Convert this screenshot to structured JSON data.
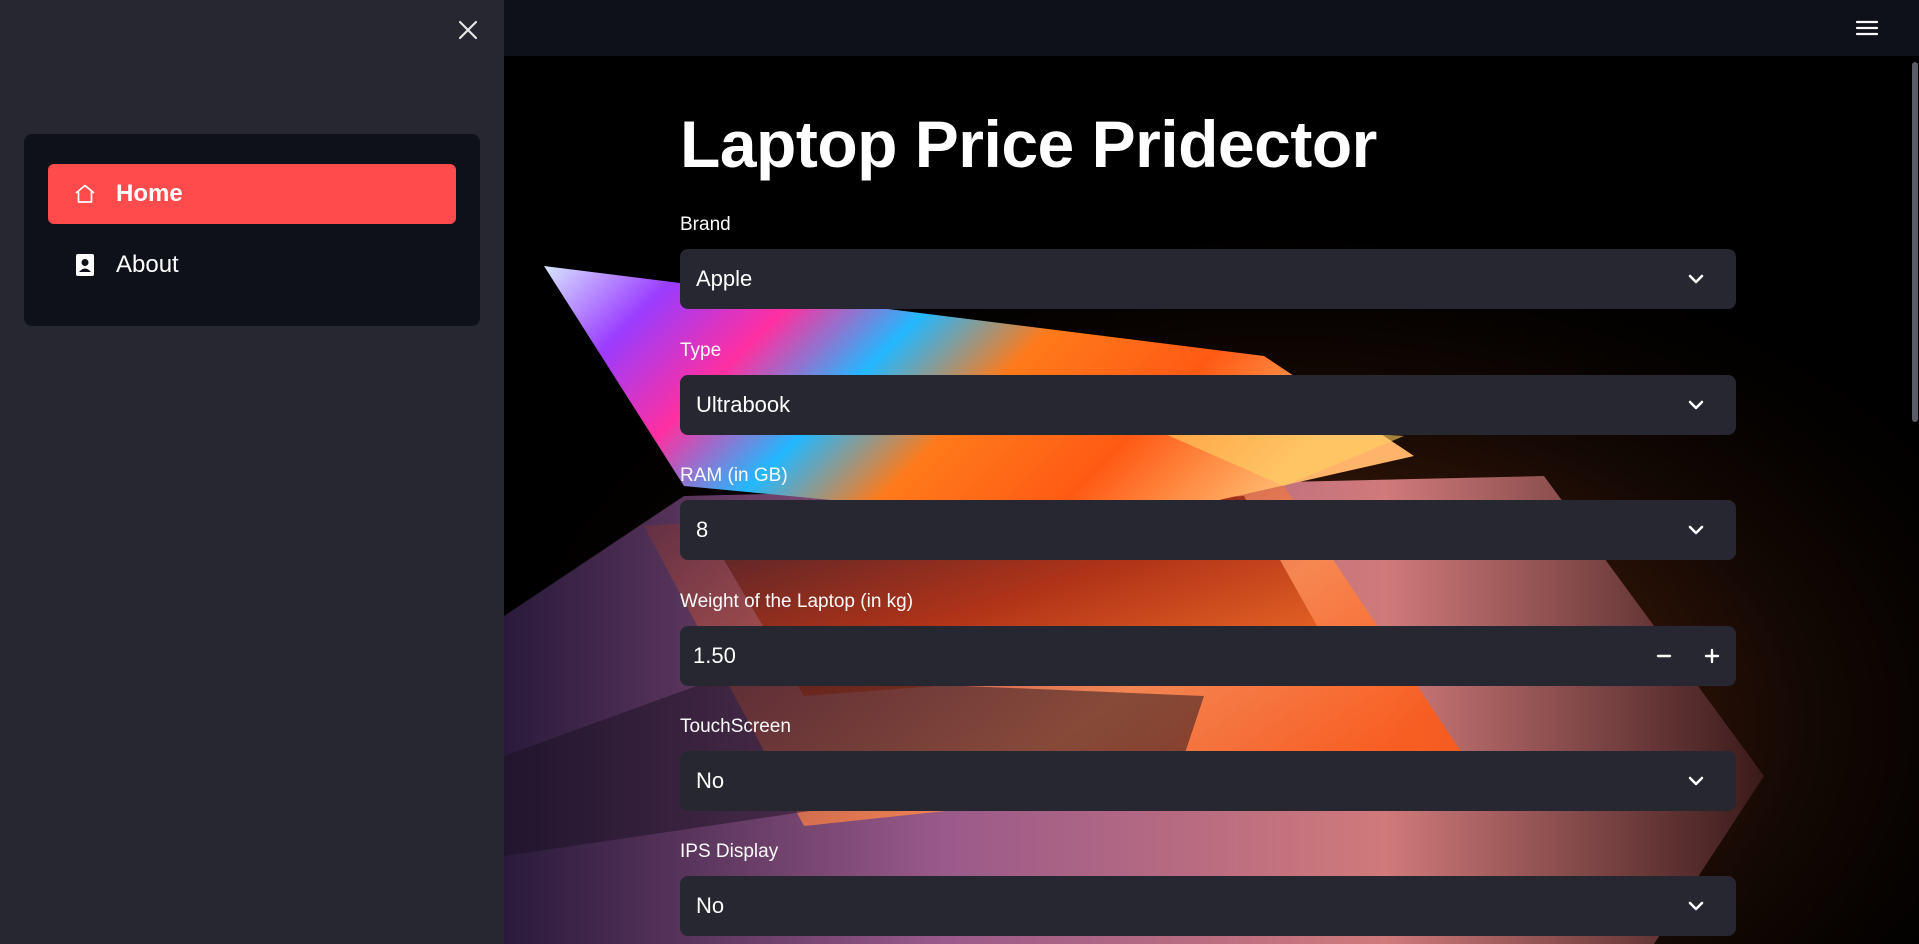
{
  "sidebar": {
    "close_icon": "close-icon",
    "items": [
      {
        "label": "Home",
        "icon": "home-icon",
        "active": true
      },
      {
        "label": "About",
        "icon": "contact-card-icon",
        "active": false
      }
    ]
  },
  "header": {
    "menu_icon": "hamburger-menu-icon"
  },
  "main": {
    "title": "Laptop Price Pridector",
    "fields": [
      {
        "label": "Brand",
        "value": "Apple",
        "kind": "select"
      },
      {
        "label": "Type",
        "value": "Ultrabook",
        "kind": "select"
      },
      {
        "label": "RAM (in GB)",
        "value": "8",
        "kind": "select"
      },
      {
        "label": "Weight of the Laptop (in kg)",
        "value": "1.50",
        "kind": "number"
      },
      {
        "label": "TouchScreen",
        "value": "No",
        "kind": "select"
      },
      {
        "label": "IPS Display",
        "value": "No",
        "kind": "select"
      }
    ]
  },
  "colors": {
    "accent": "#ff4b4b",
    "sidebar_bg": "#262730",
    "input_bg": "#262730",
    "app_bg": "#0e1117"
  }
}
